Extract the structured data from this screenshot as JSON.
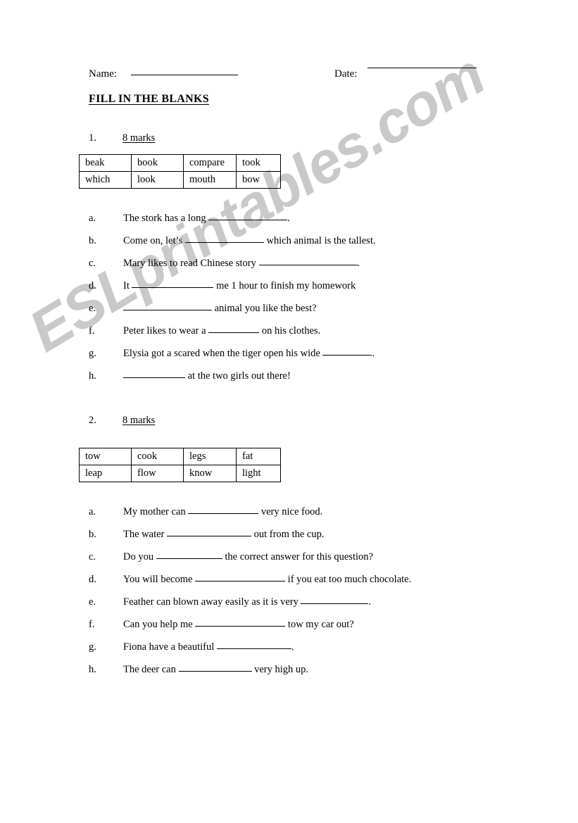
{
  "header": {
    "name_label": "Name:",
    "date_label": "Date:",
    "title": "FILL IN THE BLANKS"
  },
  "sections": [
    {
      "number": "1.",
      "marks": "8 marks",
      "wordbank": [
        [
          "beak",
          "book",
          "compare",
          "took"
        ],
        [
          "which",
          "look",
          "mouth",
          "bow"
        ]
      ],
      "questions": [
        {
          "letter": "a.",
          "before": "The stork has a long",
          "blank": 112,
          "after": "."
        },
        {
          "letter": "b.",
          "before": "Come on, let’s",
          "blank": 112,
          "after": "which animal is the tallest."
        },
        {
          "letter": "c.",
          "before": "Mary likes to read Chinese story",
          "blank": 140,
          "after": "."
        },
        {
          "letter": "d.",
          "before": "It",
          "blank": 116,
          "after": "me 1 hour to finish my homework"
        },
        {
          "letter": "e.",
          "before": "",
          "blank": 126,
          "after": "animal you like the best?"
        },
        {
          "letter": "f.",
          "before": "Peter likes to wear a",
          "blank": 72,
          "after": "on his clothes."
        },
        {
          "letter": "g.",
          "before": "Elysia got a scared when the tiger open his wide",
          "blank": 70,
          "after": "."
        },
        {
          "letter": "h.",
          "before": "",
          "blank": 88,
          "after": "at the two girls out there!"
        }
      ]
    },
    {
      "number": "2.",
      "marks": "8 marks",
      "wordbank": [
        [
          "tow",
          "cook",
          "legs",
          "fat"
        ],
        [
          "leap",
          "flow",
          "know",
          "light"
        ]
      ],
      "questions": [
        {
          "letter": "a.",
          "before": "My mother can",
          "blank": 100,
          "after": "very nice food."
        },
        {
          "letter": "b.",
          "before": "The water",
          "blank": 120,
          "after": "out from the cup."
        },
        {
          "letter": "c.",
          "before": "Do you",
          "blank": 94,
          "after": "the correct answer for this question?"
        },
        {
          "letter": "d.",
          "before": "You will become",
          "blank": 128,
          "after": "if you eat too much chocolate."
        },
        {
          "letter": "e.",
          "before": "Feather can blown away easily as it is very",
          "blank": 96,
          "after": "."
        },
        {
          "letter": "f.",
          "before": "Can you help me",
          "blank": 128,
          "after": "tow my car out?"
        },
        {
          "letter": "g.",
          "before": "Fiona have a beautiful",
          "blank": 106,
          "after": "."
        },
        {
          "letter": "h.",
          "before": "The deer can",
          "blank": 104,
          "after": "very high up."
        }
      ]
    }
  ],
  "watermark": {
    "text": "ESLprintables.com",
    "color": "#c9c9c9"
  }
}
